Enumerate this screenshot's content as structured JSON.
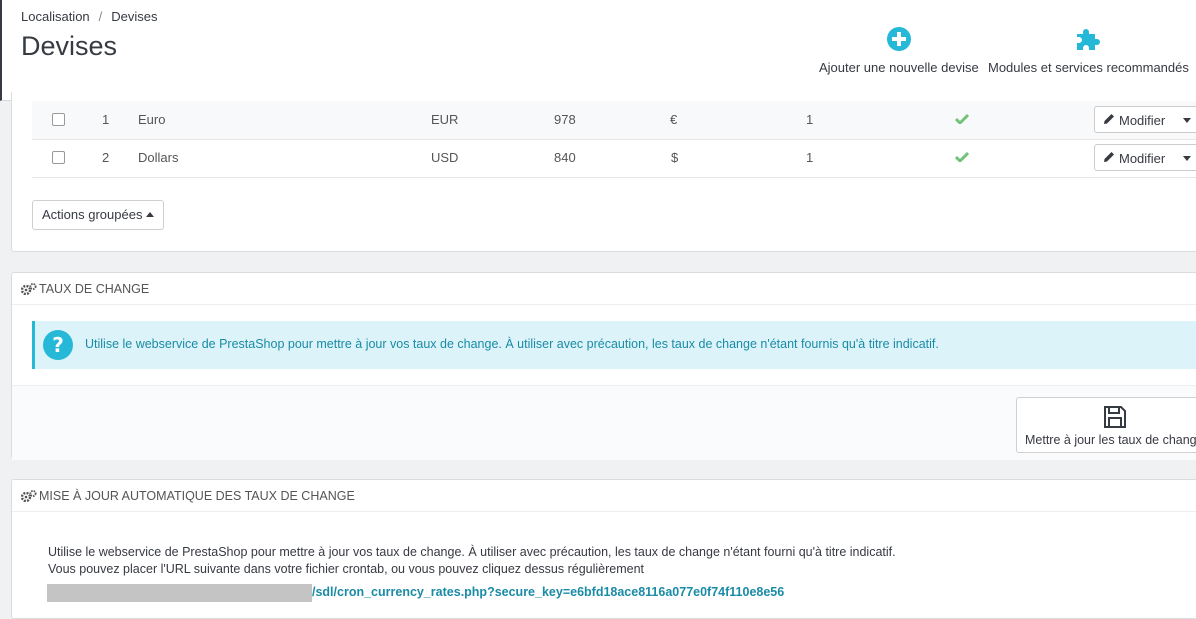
{
  "breadcrumb": {
    "parent": "Localisation",
    "separator": "/",
    "current": "Devises"
  },
  "page_title": "Devises",
  "toolbar": {
    "add_label": "Ajouter une nouvelle devise",
    "modules_label": "Modules et services recommandés"
  },
  "currencies": {
    "rows": [
      {
        "id": "1",
        "name": "Euro",
        "iso": "EUR",
        "iso_num": "978",
        "symbol": "€",
        "rate": "1",
        "enabled": true,
        "action": "Modifier"
      },
      {
        "id": "2",
        "name": "Dollars",
        "iso": "USD",
        "iso_num": "840",
        "symbol": "$",
        "rate": "1",
        "enabled": true,
        "action": "Modifier"
      }
    ],
    "bulk_actions": "Actions groupées"
  },
  "exchange": {
    "title": "TAUX DE CHANGE",
    "info": "Utilise le webservice de PrestaShop pour mettre à jour vos taux de change. À utiliser avec précaution, les taux de change n'étant fournis qu'à titre indicatif.",
    "update_button": "Mettre à jour les taux de change"
  },
  "auto_update": {
    "title": "MISE À JOUR AUTOMATIQUE DES TAUX DE CHANGE",
    "line1": "Utilise le webservice de PrestaShop pour mettre à jour vos taux de change. À utiliser avec précaution, les taux de change n'étant fourni qu'à titre indicatif.",
    "line2": "Vous pouvez placer l'URL suivante dans votre fichier crontab, ou vous pouvez cliquez dessus régulièrement",
    "cron_url_visible": "/sdl/cron_currency_rates.php?secure_key=e6bfd18ace8116a077e0f74f110e8e56"
  },
  "colors": {
    "accent": "#25b9d7",
    "success": "#72c279",
    "dark": "#363a41",
    "info_bg": "#dcf4f9",
    "info_text": "#1a8ba6"
  },
  "icons": [
    "plus-circle-icon",
    "puzzle-icon",
    "checkbox",
    "check-icon",
    "pencil-icon",
    "caret-down-icon",
    "caret-up-icon",
    "cogs-icon",
    "question-circle-icon",
    "save-icon"
  ]
}
